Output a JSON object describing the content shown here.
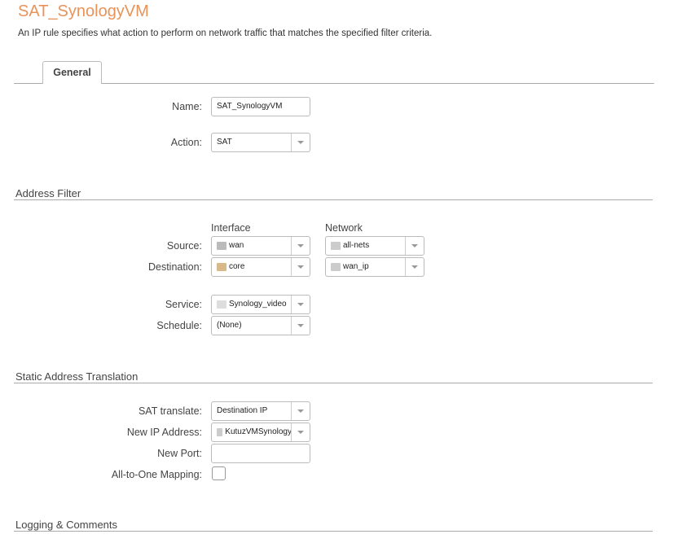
{
  "title": "SAT_SynologyVM",
  "description": "An IP rule specifies what action to perform on network traffic that matches the specified filter criteria.",
  "tabs": [
    {
      "label": "General"
    }
  ],
  "general": {
    "name_label": "Name:",
    "name_value": "SAT_SynologyVM",
    "action_label": "Action:",
    "action_value": "SAT"
  },
  "address_filter": {
    "heading": "Address Filter",
    "interface_header": "Interface",
    "network_header": "Network",
    "source_label": "Source:",
    "source_interface": "wan",
    "source_network": "all-nets",
    "destination_label": "Destination:",
    "destination_interface": "core",
    "destination_network": "wan_ip",
    "service_label": "Service:",
    "service_value": "Synology_video",
    "schedule_label": "Schedule:",
    "schedule_value": "(None)"
  },
  "sat": {
    "heading": "Static Address Translation",
    "translate_label": "SAT translate:",
    "translate_value": "Destination IP",
    "new_ip_label": "New IP Address:",
    "new_ip_value": "KutuzVMSynology",
    "new_port_label": "New Port:",
    "new_port_value": "",
    "all_to_one_label": "All-to-One Mapping:",
    "all_to_one_checked": false
  },
  "logging": {
    "heading": "Logging & Comments"
  },
  "colors": {
    "title": "#e8935a"
  }
}
